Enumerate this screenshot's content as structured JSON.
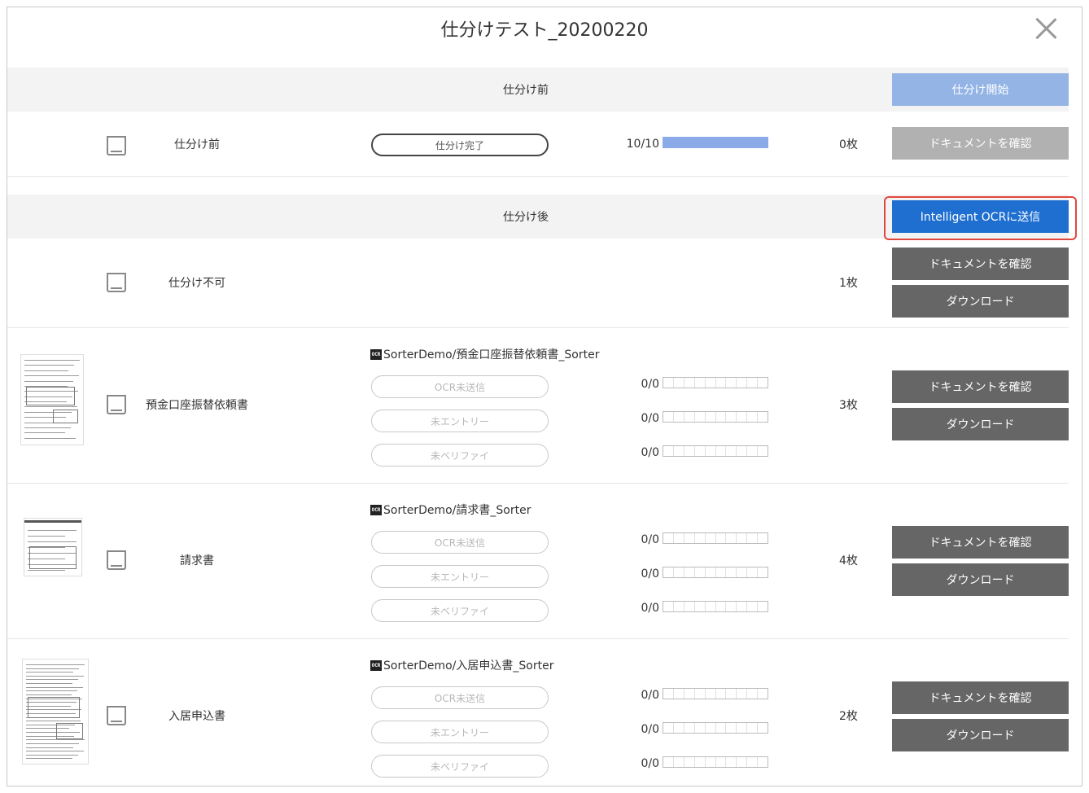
{
  "title": "仕分けテスト_20200220",
  "before_section": {
    "header": "仕分け前",
    "start_button": "仕分け開始",
    "row": {
      "name": "仕分け前",
      "status": "仕分け完了",
      "progress": "10/10",
      "progress_fraction": 1.0,
      "count": "0枚",
      "confirm_button": "ドキュメントを確認"
    }
  },
  "after_section": {
    "header": "仕分け後",
    "send_button": "Intelligent OCRに送信",
    "unsortable": {
      "name": "仕分け不可",
      "count": "1枚",
      "confirm_button": "ドキュメントを確認",
      "download_button": "ダウンロード"
    },
    "groups": [
      {
        "name": "預金口座振替依頼書",
        "ocr_badge": "OCR",
        "ocr_target": "SorterDemo/預金口座振替依頼書_Sorter",
        "count": "3枚",
        "stages": [
          {
            "label": "OCR未送信",
            "progress": "0/0"
          },
          {
            "label": "未エントリー",
            "progress": "0/0"
          },
          {
            "label": "未ベリファイ",
            "progress": "0/0"
          }
        ],
        "confirm_button": "ドキュメントを確認",
        "download_button": "ダウンロード"
      },
      {
        "name": "請求書",
        "ocr_badge": "OCR",
        "ocr_target": "SorterDemo/請求書_Sorter",
        "count": "4枚",
        "stages": [
          {
            "label": "OCR未送信",
            "progress": "0/0"
          },
          {
            "label": "未エントリー",
            "progress": "0/0"
          },
          {
            "label": "未ベリファイ",
            "progress": "0/0"
          }
        ],
        "confirm_button": "ドキュメントを確認",
        "download_button": "ダウンロード"
      },
      {
        "name": "入居申込書",
        "ocr_badge": "OCR",
        "ocr_target": "SorterDemo/入居申込書_Sorter",
        "count": "2枚",
        "stages": [
          {
            "label": "OCR未送信",
            "progress": "0/0"
          },
          {
            "label": "未エントリー",
            "progress": "0/0"
          },
          {
            "label": "未ベリファイ",
            "progress": "0/0"
          }
        ],
        "confirm_button": "ドキュメントを確認",
        "download_button": "ダウンロード"
      }
    ]
  },
  "colors": {
    "primary_blue": "#1f6fd1",
    "light_blue": "#93b4e5",
    "dark_button": "#666666",
    "disabled_button": "#b1b1b1",
    "highlight_red": "#e0473c",
    "progress_fill": "#8aaae8"
  }
}
